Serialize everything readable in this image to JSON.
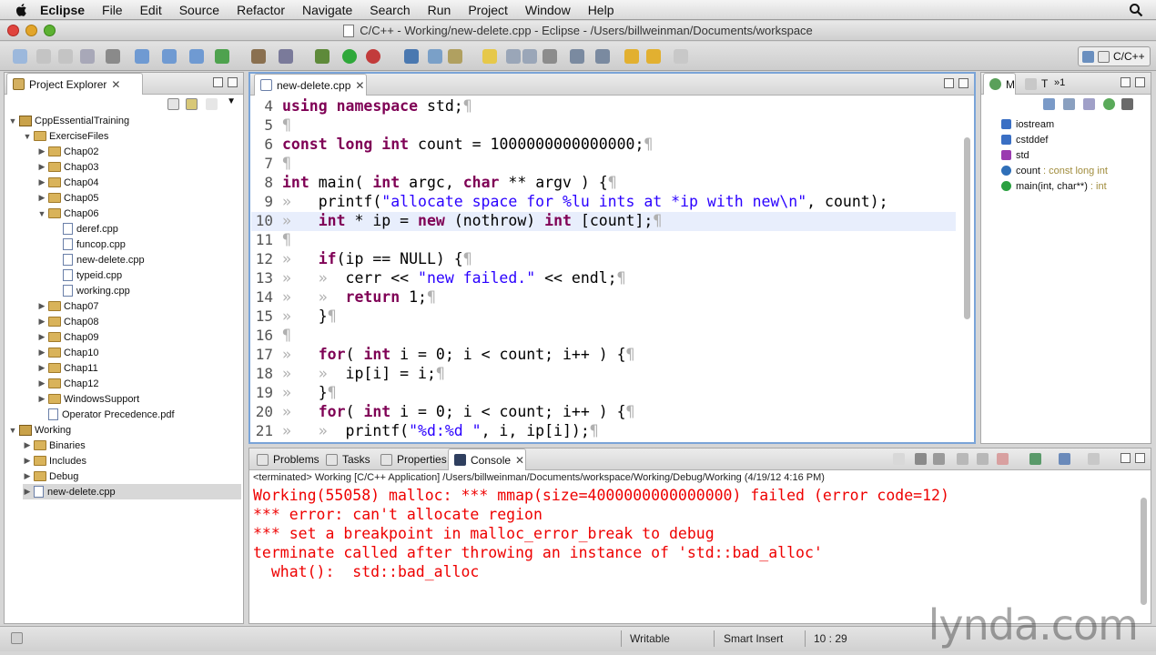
{
  "menubar": {
    "app": "Eclipse",
    "items": [
      "File",
      "Edit",
      "Source",
      "Refactor",
      "Navigate",
      "Search",
      "Run",
      "Project",
      "Window",
      "Help"
    ]
  },
  "window": {
    "title": "C/C++ - Working/new-delete.cpp - Eclipse - /Users/billweinman/Documents/workspace"
  },
  "toolbar": {
    "perspective": "C/C++"
  },
  "project_explorer": {
    "tab": "Project Explorer",
    "tree": [
      {
        "label": "CppEssentialTraining",
        "depth": 0,
        "kind": "project",
        "open": true
      },
      {
        "label": "ExerciseFiles",
        "depth": 1,
        "kind": "folder",
        "open": true
      },
      {
        "label": "Chap02",
        "depth": 2,
        "kind": "folder",
        "open": false
      },
      {
        "label": "Chap03",
        "depth": 2,
        "kind": "folder",
        "open": false
      },
      {
        "label": "Chap04",
        "depth": 2,
        "kind": "folder",
        "open": false
      },
      {
        "label": "Chap05",
        "depth": 2,
        "kind": "folder",
        "open": false
      },
      {
        "label": "Chap06",
        "depth": 2,
        "kind": "folder",
        "open": true
      },
      {
        "label": "deref.cpp",
        "depth": 3,
        "kind": "file"
      },
      {
        "label": "funcop.cpp",
        "depth": 3,
        "kind": "file"
      },
      {
        "label": "new-delete.cpp",
        "depth": 3,
        "kind": "file"
      },
      {
        "label": "typeid.cpp",
        "depth": 3,
        "kind": "file"
      },
      {
        "label": "working.cpp",
        "depth": 3,
        "kind": "file"
      },
      {
        "label": "Chap07",
        "depth": 2,
        "kind": "folder",
        "open": false
      },
      {
        "label": "Chap08",
        "depth": 2,
        "kind": "folder",
        "open": false
      },
      {
        "label": "Chap09",
        "depth": 2,
        "kind": "folder",
        "open": false
      },
      {
        "label": "Chap10",
        "depth": 2,
        "kind": "folder",
        "open": false
      },
      {
        "label": "Chap11",
        "depth": 2,
        "kind": "folder",
        "open": false
      },
      {
        "label": "Chap12",
        "depth": 2,
        "kind": "folder",
        "open": false
      },
      {
        "label": "WindowsSupport",
        "depth": 2,
        "kind": "folder",
        "open": false
      },
      {
        "label": "Operator Precedence.pdf",
        "depth": 2,
        "kind": "pdf"
      },
      {
        "label": "Working",
        "depth": 0,
        "kind": "project",
        "open": true
      },
      {
        "label": "Binaries",
        "depth": 1,
        "kind": "folder",
        "open": false
      },
      {
        "label": "Includes",
        "depth": 1,
        "kind": "folder",
        "open": false
      },
      {
        "label": "Debug",
        "depth": 1,
        "kind": "folder",
        "open": false
      },
      {
        "label": "new-delete.cpp",
        "depth": 1,
        "kind": "file",
        "open": false,
        "selected": true
      }
    ]
  },
  "editor": {
    "tab": "new-delete.cpp",
    "lines": [
      {
        "n": "4",
        "segs": [
          [
            "kw",
            "using"
          ],
          [
            "t",
            " "
          ],
          [
            "kw",
            "namespace"
          ],
          [
            "t",
            " std;"
          ],
          [
            "p",
            "¶"
          ]
        ]
      },
      {
        "n": "5",
        "segs": [
          [
            "p",
            "¶"
          ]
        ]
      },
      {
        "n": "6",
        "segs": [
          [
            "kw",
            "const"
          ],
          [
            "t",
            " "
          ],
          [
            "kw",
            "long"
          ],
          [
            "t",
            " "
          ],
          [
            "kw",
            "int"
          ],
          [
            "t",
            " count = 1000000000000000;"
          ],
          [
            "p",
            "¶"
          ]
        ]
      },
      {
        "n": "7",
        "segs": [
          [
            "p",
            "¶"
          ]
        ]
      },
      {
        "n": "8",
        "segs": [
          [
            "kw",
            "int"
          ],
          [
            "t",
            " main( "
          ],
          [
            "kw",
            "int"
          ],
          [
            "t",
            " argc, "
          ],
          [
            "kw",
            "char"
          ],
          [
            "t",
            " ** argv ) {"
          ],
          [
            "p",
            "¶"
          ]
        ]
      },
      {
        "n": "9",
        "segs": [
          [
            "p",
            "» "
          ],
          [
            "t",
            "  printf("
          ],
          [
            "str",
            "\"allocate space for %lu ints at *ip with new\\n\""
          ],
          [
            "t",
            ", count);"
          ]
        ]
      },
      {
        "n": "10",
        "segs": [
          [
            "p",
            "» "
          ],
          [
            "t",
            "  "
          ],
          [
            "kw",
            "int"
          ],
          [
            "t",
            " * ip = "
          ],
          [
            "kw",
            "new"
          ],
          [
            "t",
            " (nothrow) "
          ],
          [
            "kw",
            "int"
          ],
          [
            "t",
            " [count];"
          ],
          [
            "p",
            "¶"
          ]
        ],
        "current": true
      },
      {
        "n": "11",
        "segs": [
          [
            "p",
            "¶"
          ]
        ]
      },
      {
        "n": "12",
        "segs": [
          [
            "p",
            "» "
          ],
          [
            "t",
            "  "
          ],
          [
            "kw",
            "if"
          ],
          [
            "t",
            "(ip == NULL) {"
          ],
          [
            "p",
            "¶"
          ]
        ]
      },
      {
        "n": "13",
        "segs": [
          [
            "p",
            "»   »"
          ],
          [
            "t",
            "  cerr << "
          ],
          [
            "str",
            "\"new failed.\""
          ],
          [
            "t",
            " << endl;"
          ],
          [
            "p",
            "¶"
          ]
        ]
      },
      {
        "n": "14",
        "segs": [
          [
            "p",
            "»   »"
          ],
          [
            "t",
            "  "
          ],
          [
            "kw",
            "return"
          ],
          [
            "t",
            " 1;"
          ],
          [
            "p",
            "¶"
          ]
        ]
      },
      {
        "n": "15",
        "segs": [
          [
            "p",
            "» "
          ],
          [
            "t",
            "  }"
          ],
          [
            "p",
            "¶"
          ]
        ]
      },
      {
        "n": "16",
        "segs": [
          [
            "p",
            "¶"
          ]
        ]
      },
      {
        "n": "17",
        "segs": [
          [
            "p",
            "» "
          ],
          [
            "t",
            "  "
          ],
          [
            "kw",
            "for"
          ],
          [
            "t",
            "( "
          ],
          [
            "kw",
            "int"
          ],
          [
            "t",
            " i = 0; i < count; i++ ) {"
          ],
          [
            "p",
            "¶"
          ]
        ]
      },
      {
        "n": "18",
        "segs": [
          [
            "p",
            "»   »"
          ],
          [
            "t",
            "  ip[i] = i;"
          ],
          [
            "p",
            "¶"
          ]
        ]
      },
      {
        "n": "19",
        "segs": [
          [
            "p",
            "» "
          ],
          [
            "t",
            "  }"
          ],
          [
            "p",
            "¶"
          ]
        ]
      },
      {
        "n": "20",
        "segs": [
          [
            "p",
            "» "
          ],
          [
            "t",
            "  "
          ],
          [
            "kw",
            "for"
          ],
          [
            "t",
            "( "
          ],
          [
            "kw",
            "int"
          ],
          [
            "t",
            " i = 0; i < count; i++ ) {"
          ],
          [
            "p",
            "¶"
          ]
        ]
      },
      {
        "n": "21",
        "segs": [
          [
            "p",
            "»   »"
          ],
          [
            "t",
            "  printf("
          ],
          [
            "str",
            "\"%d:%d \""
          ],
          [
            "t",
            ", i, ip[i]);"
          ],
          [
            "p",
            "¶"
          ]
        ]
      }
    ]
  },
  "outline": {
    "tabs": [
      "M",
      "T"
    ],
    "items": [
      {
        "label": "iostream",
        "sub": "",
        "icon": "include-icon",
        "color": "#3a6fc4"
      },
      {
        "label": "cstddef",
        "sub": "",
        "icon": "include-icon",
        "color": "#3a6fc4"
      },
      {
        "label": "std",
        "sub": "",
        "icon": "namespace-icon",
        "color": "#9a3ab0"
      },
      {
        "label": "count",
        "sub": " : const long int",
        "icon": "field-icon",
        "color": "#2f6fb8"
      },
      {
        "label": "main(int, char**)",
        "sub": " : int",
        "icon": "function-icon",
        "color": "#2aa040"
      }
    ]
  },
  "console": {
    "tabs": [
      "Problems",
      "Tasks",
      "Properties",
      "Console"
    ],
    "active_tab": "Console",
    "status": "<terminated> Working [C/C++ Application] /Users/billweinman/Documents/workspace/Working/Debug/Working (4/19/12 4:16 PM)",
    "output": [
      "Working(55058) malloc: *** mmap(size=4000000000000000) failed (error code=12)",
      "*** error: can't allocate region",
      "*** set a breakpoint in malloc_error_break to debug",
      "terminate called after throwing an instance of 'std::bad_alloc'",
      "  what():  std::bad_alloc"
    ]
  },
  "statusbar": {
    "writable": "Writable",
    "insert_mode": "Smart Insert",
    "position": "10 : 29"
  },
  "watermark": "lynda.com",
  "colors": {
    "keyword": "#7f0055",
    "string": "#2a00ff",
    "console_error": "#e00000",
    "selection": "#d8d8d8"
  }
}
